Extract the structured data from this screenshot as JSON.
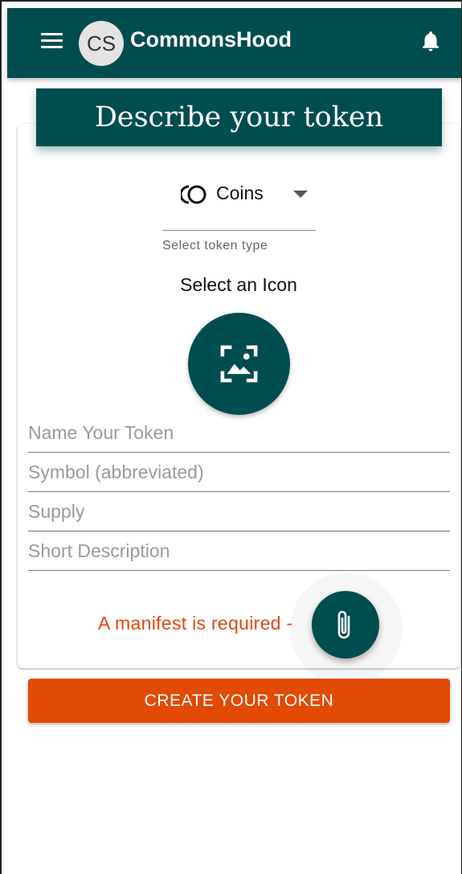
{
  "app_bar": {
    "avatar_initials": "CS",
    "title": "CommonsHood",
    "menu_icon": "menu-icon",
    "notification_icon": "bell-icon",
    "background_color": "#004d50"
  },
  "form": {
    "header_title": "Describe your token",
    "token_type": {
      "icon": "coins-icon",
      "selected_value": "Coins",
      "helper_text": "Select token type"
    },
    "icon_picker": {
      "label": "Select an Icon",
      "icon": "image-icon"
    },
    "fields": {
      "name_placeholder": "Name Your Token",
      "symbol_placeholder": "Symbol (abbreviated)",
      "supply_placeholder": "Supply",
      "description_placeholder": "Short Description"
    },
    "manifest": {
      "message": "A manifest is required -",
      "attach_icon": "paperclip-icon",
      "message_color": "#e0480c"
    }
  },
  "actions": {
    "create_label": "CREATE YOUR TOKEN",
    "create_color": "#e34a04"
  }
}
